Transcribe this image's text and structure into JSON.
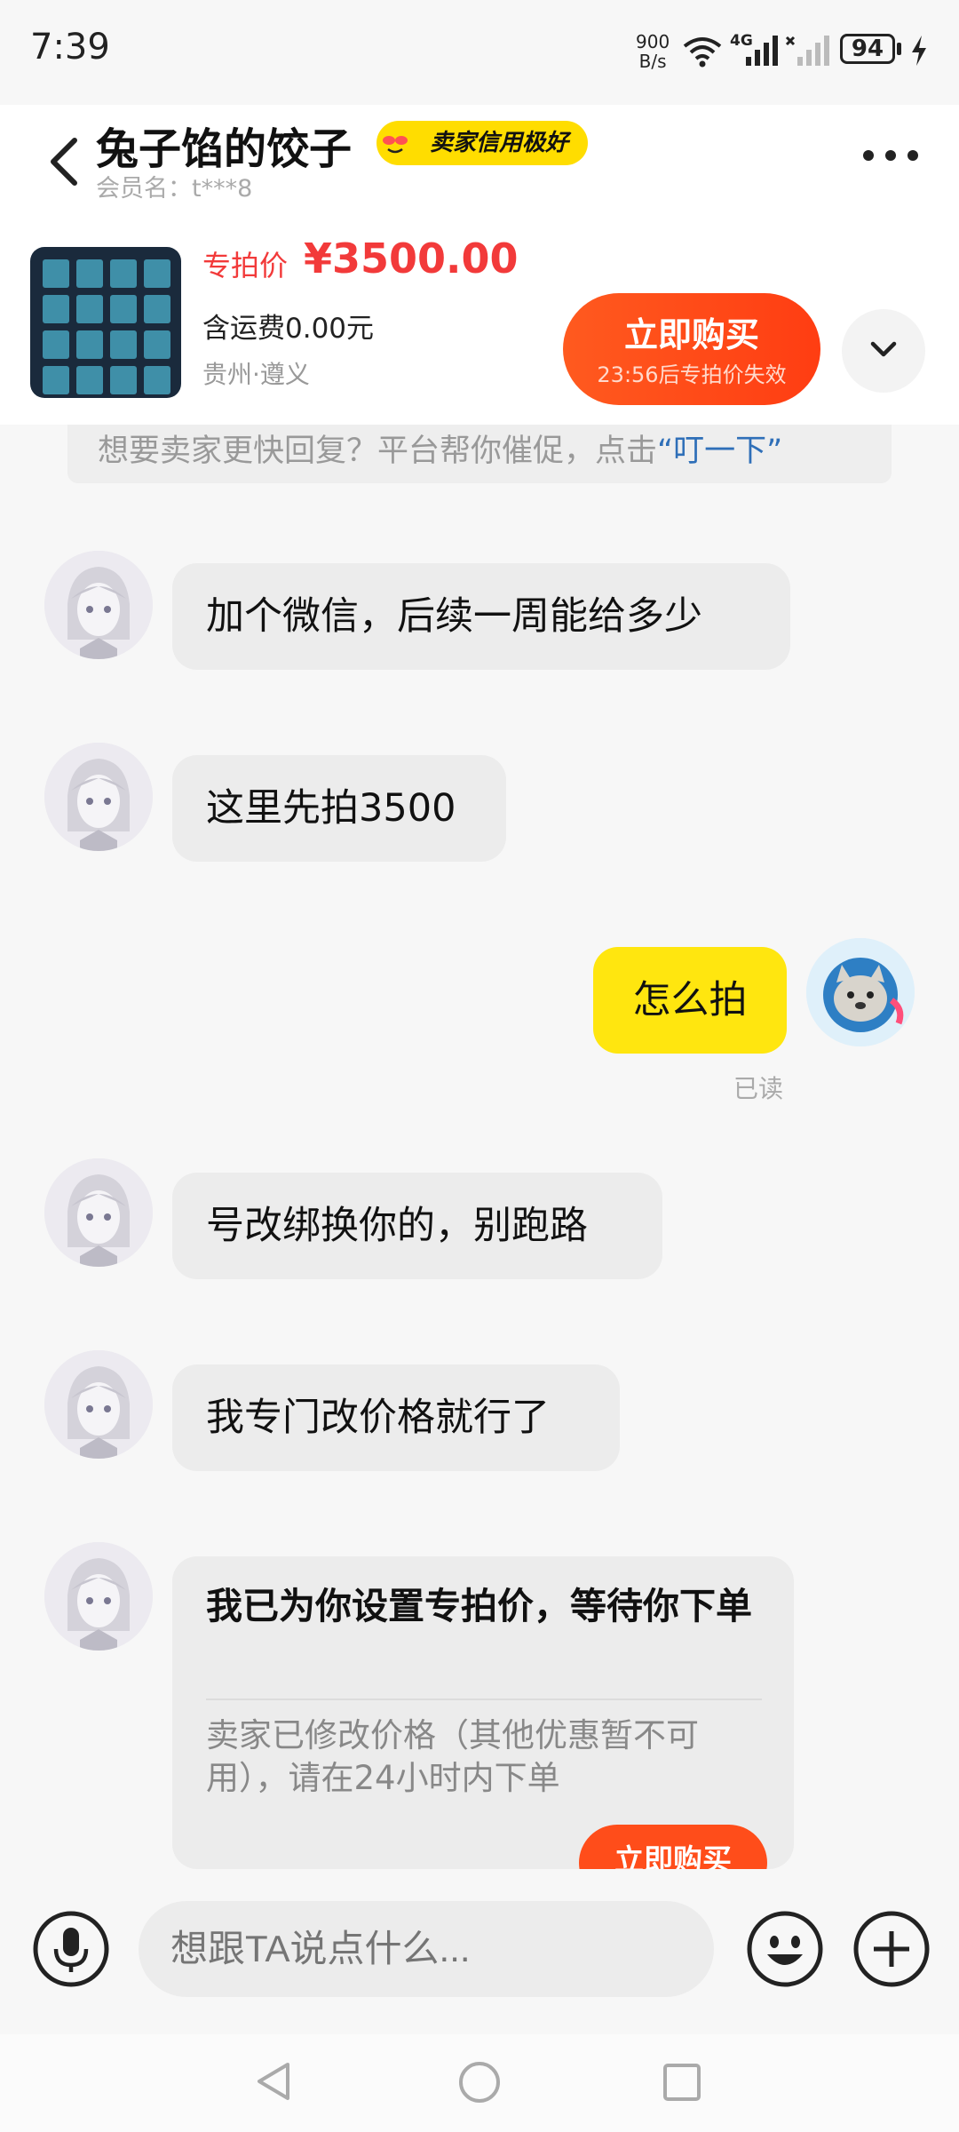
{
  "status_bar": {
    "time": "7:39",
    "net_speed_value": "900",
    "net_speed_unit": "B/s",
    "network": "4G",
    "battery": "94"
  },
  "header": {
    "title": "兔子馅的饺子",
    "seller_badge": "卖家信用极好",
    "member_name": "会员名：t***8"
  },
  "product": {
    "price_label": "专拍价",
    "price": "¥3500.00",
    "shipping": "含运费0.00元",
    "location": "贵州·遵义",
    "buy_label": "立即购买",
    "buy_countdown": "23:56后专拍价失效"
  },
  "notice": {
    "text": "想要卖家更快回复？平台帮你催促，点击",
    "link": "“叮一下”"
  },
  "messages": [
    {
      "text": "加个微信，后续一周能给多少"
    },
    {
      "text": "这里先拍3500"
    },
    {
      "text": "怎么拍",
      "status": "已读"
    },
    {
      "text": "号改绑换你的，别跑路"
    },
    {
      "text": "我专门改价格就行了"
    }
  ],
  "price_card": {
    "title": "我已为你设置专拍价，等待你下单",
    "description": "卖家已修改价格（其他优惠暂不可用），请在24小时内下单",
    "button": "立即购买"
  },
  "input": {
    "placeholder": "想跟TA说点什么..."
  },
  "icons": {
    "back": "chevron-left-icon",
    "more": "more-dots-icon",
    "expand": "chevron-down-icon",
    "mic": "microphone-icon",
    "emoji": "emoji-icon",
    "plus": "plus-icon"
  },
  "colors": {
    "accent": "#ff4d1a",
    "price": "#f23a3a",
    "own_bubble": "#ffe60f",
    "badge": "#ffdd00",
    "link": "#2f6fb8"
  }
}
